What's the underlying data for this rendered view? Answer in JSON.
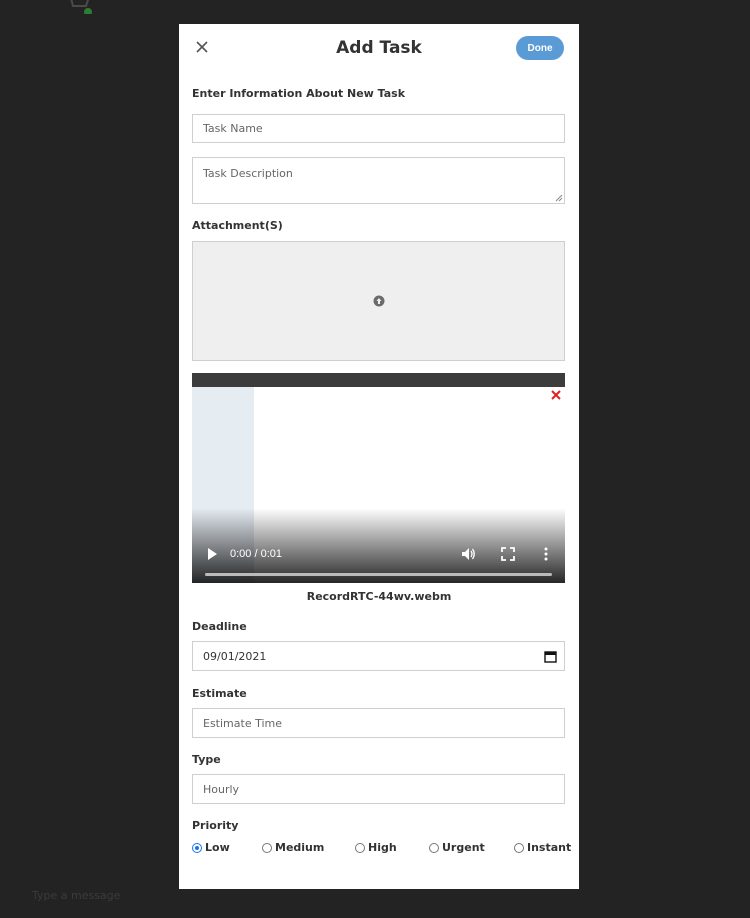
{
  "background": {
    "chat_placeholder": "Type a message"
  },
  "modal": {
    "title": "Add Task",
    "done_label": "Done",
    "intro": "Enter Information About New Task",
    "task_name_placeholder": "Task Name",
    "task_description_placeholder": "Task Description",
    "attachments_label": "Attachment(S)",
    "attachment": {
      "file_name": "RecordRTC-44wv.webm",
      "time": "0:00 / 0:01",
      "progress": 0
    },
    "deadline_label": "Deadline",
    "deadline_value": "09/01/2021",
    "estimate_label": "Estimate",
    "estimate_placeholder": "Estimate Time",
    "type_label": "Type",
    "type_value": "Hourly",
    "priority_label": "Priority",
    "priority_options": [
      "Low",
      "Medium",
      "High",
      "Urgent",
      "Instant"
    ],
    "priority_selected": "Low"
  },
  "colors": {
    "accent": "#5b9bd5",
    "overlay": "#232323",
    "radio_checked": "#1a73e8"
  }
}
